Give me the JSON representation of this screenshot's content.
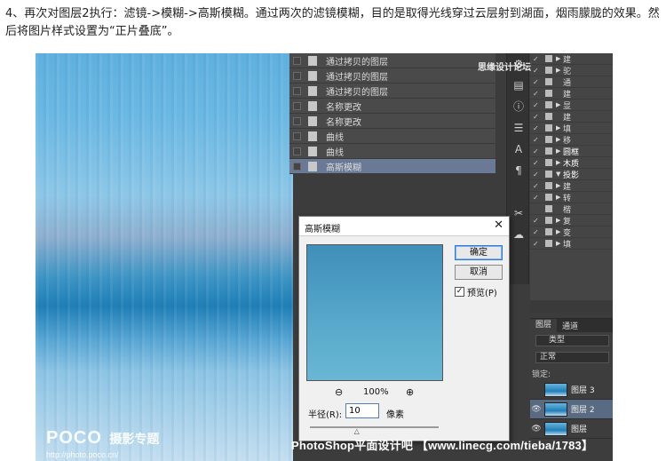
{
  "instruction": {
    "text": "4、再次对图层2执行：滤镜->模糊->高斯模糊。通过两次的滤镜模糊，目的是取得光线穿过云层射到湖面，烟雨朦胧的效果。然后将图片样式设置为“正片叠底”。"
  },
  "history_panel": {
    "items": [
      {
        "label": "通过拷贝的图层",
        "selected": false
      },
      {
        "label": "通过拷贝的图层",
        "selected": false
      },
      {
        "label": "通过拷贝的图层",
        "selected": false
      },
      {
        "label": "名称更改",
        "selected": false
      },
      {
        "label": "名称更改",
        "selected": false
      },
      {
        "label": "曲线",
        "selected": false
      },
      {
        "label": "曲线",
        "selected": false
      },
      {
        "label": "高斯模糊",
        "selected": true
      }
    ]
  },
  "right_panel_rows": [
    {
      "label": "建",
      "expanded": true
    },
    {
      "label": "驼",
      "expanded": true
    },
    {
      "label": "通",
      "expanded": false
    },
    {
      "label": "建",
      "expanded": false
    },
    {
      "label": "显",
      "expanded": true
    },
    {
      "label": "建",
      "expanded": false
    },
    {
      "label": "填",
      "expanded": true
    },
    {
      "label": "移",
      "expanded": true
    },
    {
      "label": "圆框",
      "expanded": true
    },
    {
      "label": "木质",
      "expanded": true
    },
    {
      "label": "投影",
      "expanded": true
    },
    {
      "label": "建",
      "expanded": false
    },
    {
      "label": "转",
      "expanded": true
    },
    {
      "label": "楷",
      "expanded": false
    },
    {
      "label": "复",
      "expanded": false
    },
    {
      "label": "变",
      "expanded": true
    },
    {
      "label": "填",
      "expanded": true
    }
  ],
  "layers_panel": {
    "tabs": [
      "图层",
      "通道"
    ],
    "kind_filter": "类型",
    "blend_mode": "正常",
    "lock_label": "锁定:",
    "layers": [
      {
        "name": "图层 3",
        "visible": false,
        "selected": false
      },
      {
        "name": "图层 2",
        "visible": true,
        "selected": true
      },
      {
        "name": "图层",
        "visible": true,
        "selected": false
      }
    ]
  },
  "dialog": {
    "title": "高斯模糊",
    "ok_label": "确定",
    "cancel_label": "取消",
    "preview_label": "预览(P)",
    "preview_checked": "✓",
    "zoom_percent": "100%",
    "radius_label": "半径(R):",
    "radius_value": "10",
    "radius_unit": "像素",
    "slider_position": 0.37,
    "close_icon": "close-icon",
    "zoom_out_icon": "zoom-out-icon",
    "zoom_in_icon": "zoom-in-icon"
  },
  "photo": {
    "watermark_logo": "POCO",
    "watermark_sub": "摄影专题",
    "watermark_url": "http://photo.poco.cn/"
  },
  "watermarks": {
    "top_right": "思缘设计论坛",
    "bottom": "PhotoShop平面设计吧 【www.linecg.com/tieba/1783】"
  }
}
